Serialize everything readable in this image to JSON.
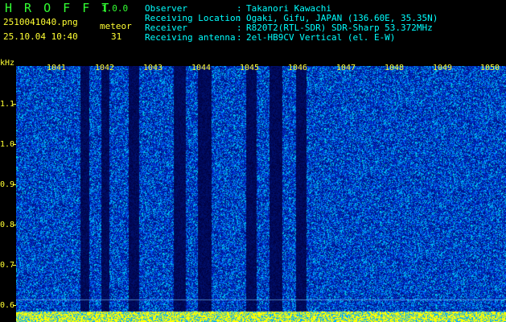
{
  "app": {
    "title": "H R O F F T",
    "version": "1.0.0"
  },
  "file": {
    "name": "2510041040.png",
    "datetime": "25.10.04 10:40"
  },
  "meteor": {
    "label": "meteor",
    "count": "31"
  },
  "info": [
    {
      "key": "Observer",
      "value": "Takanori Kawachi"
    },
    {
      "key": "Receiving Location",
      "value": "Ogaki, Gifu, JAPAN (136.60E, 35.35N)"
    },
    {
      "key": "Receiver",
      "value": "R820T2(RTL-SDR) SDR-Sharp 53.372MHz"
    },
    {
      "key": "Receiving antenna",
      "value": "2el-HB9CV Vertical (el. E-W)"
    }
  ],
  "yaxis": {
    "unit": "kHz",
    "labels": [
      "1.1",
      "1.0",
      "0.9",
      "0.8",
      "0.7",
      "0.6"
    ]
  },
  "xaxis": {
    "labels": [
      "1041",
      "1042",
      "1043",
      "1044",
      "1045",
      "1046",
      "1047",
      "1048",
      "1049",
      "1050"
    ]
  },
  "colors": {
    "accent_yellow": "#ffff33",
    "info_cyan": "#00ffff",
    "app_green": "#33ff33",
    "background": "#000000"
  }
}
